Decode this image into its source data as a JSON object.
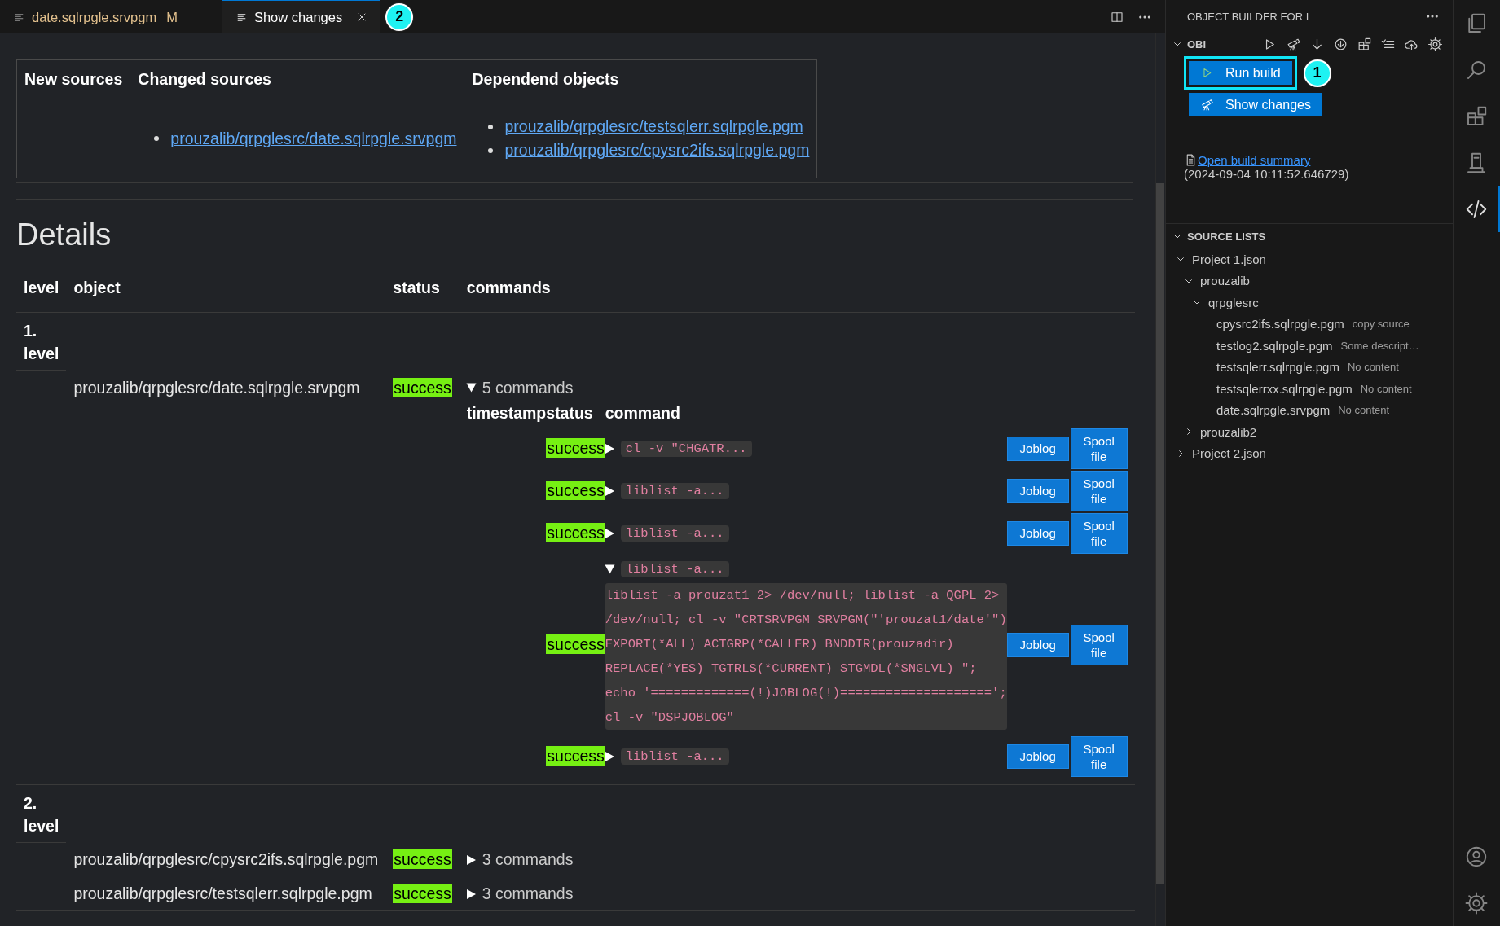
{
  "editor": {
    "tabs": [
      {
        "label": "date.sqlrpgle.srvpgm",
        "badge": "M",
        "modified": true,
        "selected": false
      },
      {
        "label": "Show changes",
        "modified": false,
        "selected": true,
        "callout": "2"
      }
    ],
    "changes_table": {
      "columns": [
        {
          "header": "New sources"
        },
        {
          "header": "Changed sources",
          "links": [
            "prouzalib/qrpglesrc/date.sqlrpgle.srvpgm"
          ]
        },
        {
          "header": "Dependend objects",
          "links": [
            "prouzalib/qrpglesrc/testsqlerr.sqlrpgle.pgm",
            "prouzalib/qrpglesrc/cpysrc2ifs.sqlrpgle.pgm"
          ]
        }
      ]
    },
    "details": {
      "title": "Details",
      "columns": [
        "level",
        "object",
        "status",
        "commands"
      ],
      "levels": [
        {
          "label": "1. level",
          "objects": [
            {
              "path": "prouzalib/qrpglesrc/date.sqlrpgle.srvpgm",
              "status": {
                "label": "success",
                "kind": "success"
              },
              "summary": "5 commands",
              "expanded": true,
              "command_columns": [
                "timestamp",
                "status",
                "command"
              ],
              "commands": [
                {
                  "status": {
                    "label": "success",
                    "kind": "success"
                  },
                  "command": "cl -v \"CHGATR...",
                  "expanded": false,
                  "buttons": [
                    "Joblog",
                    "Spool file"
                  ]
                },
                {
                  "status": {
                    "label": "success",
                    "kind": "success"
                  },
                  "command": "liblist -a...",
                  "expanded": false,
                  "buttons": [
                    "Joblog",
                    "Spool file"
                  ]
                },
                {
                  "status": {
                    "label": "success",
                    "kind": "success"
                  },
                  "command": "liblist -a...",
                  "expanded": false,
                  "buttons": [
                    "Joblog",
                    "Spool file"
                  ]
                },
                {
                  "status": {
                    "label": "success",
                    "kind": "success"
                  },
                  "command": "liblist -a...",
                  "expanded": true,
                  "output": "liblist -a prouzat1 2> /dev/null; liblist -a QGPL 2> /dev/null; cl -v \"CRTSRVPGM SRVPGM(\"'prouzat1/date'\") EXPORT(*ALL) ACTGRP(*CALLER) BNDDIR(prouzadir) REPLACE(*YES) TGTRLS(*CURRENT) STGMDL(*SNGLVL) \"; echo '=============(!)JOBLOG(!)===================='; cl -v \"DSPJOBLOG\"",
                  "buttons": [
                    "Joblog",
                    "Spool file"
                  ]
                },
                {
                  "status": {
                    "label": "success",
                    "kind": "success"
                  },
                  "command": "liblist -a...",
                  "expanded": false,
                  "buttons": [
                    "Joblog",
                    "Spool file"
                  ]
                }
              ]
            }
          ]
        },
        {
          "label": "2. level",
          "objects": [
            {
              "path": "prouzalib/qrpglesrc/cpysrc2ifs.sqlrpgle.pgm",
              "status": {
                "label": "success",
                "kind": "success"
              },
              "summary": "3 commands",
              "expanded": false
            },
            {
              "path": "prouzalib/qrpglesrc/testsqlerr.sqlrpgle.pgm",
              "status": {
                "label": "success",
                "kind": "success"
              },
              "summary": "3 commands",
              "expanded": false
            }
          ]
        }
      ]
    }
  },
  "sidebar": {
    "title": "OBJECT BUILDER FOR I",
    "obi": {
      "title": "OBI",
      "expanded": true,
      "buttons": [
        {
          "label": "Run build",
          "kind": "run",
          "highlighted": true,
          "callout": "1"
        },
        {
          "label": "Show changes",
          "kind": "changes",
          "highlighted": false
        }
      ],
      "summary_link": "Open build summary",
      "summary_time": "(2024-09-04 10:11:52.646729)"
    },
    "source_lists": {
      "title": "SOURCE LISTS",
      "expanded": true,
      "tree": [
        {
          "label": "Project 1.json",
          "expanded": true,
          "children": [
            {
              "label": "prouzalib",
              "expanded": true,
              "children": [
                {
                  "label": "qrpglesrc",
                  "expanded": true,
                  "children": [
                    {
                      "label": "cpysrc2ifs.sqlrpgle.pgm",
                      "description": "copy source"
                    },
                    {
                      "label": "testlog2.sqlrpgle.pgm",
                      "description": "Some descript…"
                    },
                    {
                      "label": "testsqlerr.sqlrpgle.pgm",
                      "description": "No content"
                    },
                    {
                      "label": "testsqlerrxx.sqlrpgle.pgm",
                      "description": "No content"
                    },
                    {
                      "label": "date.sqlrpgle.srvpgm",
                      "description": "No content"
                    }
                  ]
                }
              ]
            },
            {
              "label": "prouzalib2",
              "expanded": false
            }
          ]
        },
        {
          "label": "Project 2.json",
          "expanded": false
        }
      ]
    }
  }
}
